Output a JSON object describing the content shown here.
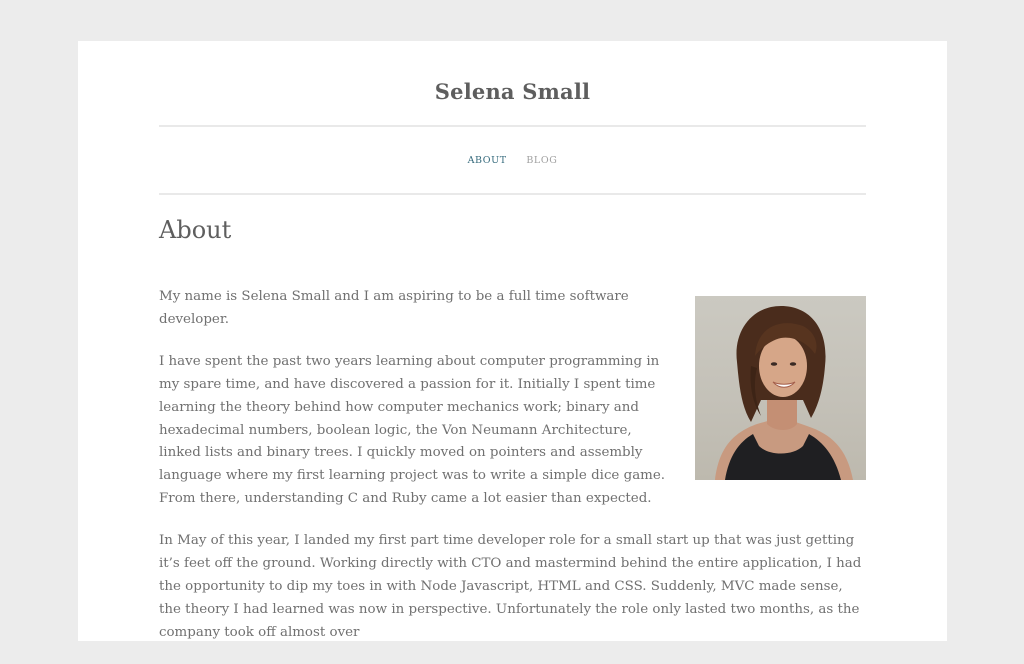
{
  "site": {
    "title": "Selena Small"
  },
  "nav": {
    "items": [
      {
        "label": "ABOUT",
        "current": true
      },
      {
        "label": "BLOG",
        "current": false
      }
    ]
  },
  "page": {
    "heading": "About",
    "paragraphs": [
      "My name is Selena Small and I am aspiring to be a full time software developer.",
      "I have spent the past two years learning about computer programming in my spare time, and have discovered a passion for it. Initially I spent time learning the theory behind how computer mechanics work; binary and hexadecimal numbers, boolean logic, the Von Neumann Architecture, linked lists and binary trees. I quickly moved on pointers and assembly language where my first learning project was to write a simple dice game. From there, understanding C and Ruby came a lot easier than expected.",
      "In May of this year, I landed my first part time developer role for a small start up that was just getting it’s feet off the ground. Working directly with CTO and mastermind behind the entire application, I had the opportunity to dip my toes in with Node Javascript, HTML and CSS. Suddenly, MVC made sense, the theory I had learned was now in perspective. Unfortunately the role only lasted two months, as the company took off almost over"
    ]
  },
  "colors": {
    "background": "#ececec",
    "card": "#ffffff",
    "accent": "#356a7c",
    "text": "#707070"
  }
}
